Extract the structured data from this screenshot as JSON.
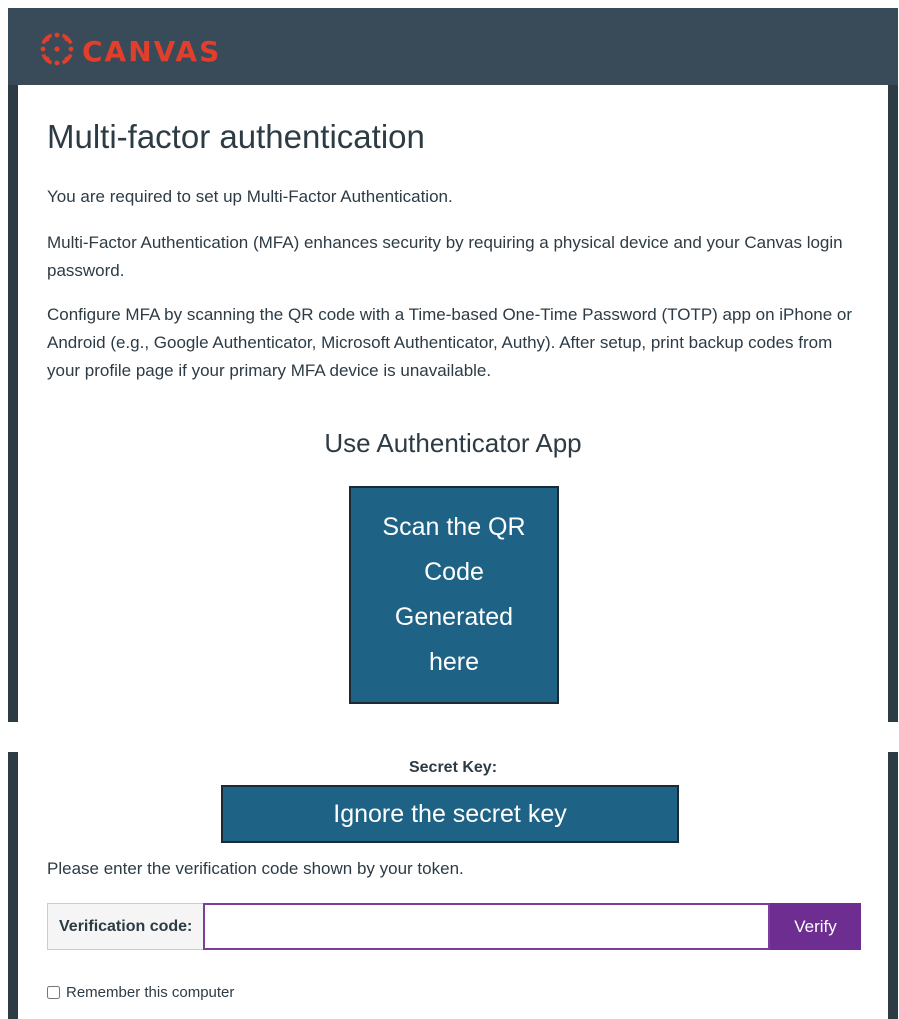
{
  "brand": {
    "name": "CANVAS",
    "logo_icon": "canvas-logo-icon",
    "color": "#e13f2b"
  },
  "page": {
    "title": "Multi-factor authentication",
    "paragraphs": [
      "You are required to set up Multi-Factor Authentication.",
      "Multi-Factor Authentication (MFA) enhances security by requiring a physical device and your Canvas login password.",
      "Configure MFA by scanning the QR code with a Time-based One-Time Password (TOTP) app on iPhone or Android (e.g., Google Authenticator, Microsoft Authenticator, Authy). After setup, print backup codes from your profile page if your primary MFA device is unavailable."
    ]
  },
  "authenticator": {
    "heading": "Use Authenticator App",
    "qr_placeholder": "Scan the QR Code Generated here",
    "secret_label": "Secret Key:",
    "secret_placeholder": "Ignore the secret key"
  },
  "verification": {
    "instruction": "Please enter the verification code shown by your token.",
    "label": "Verification code:",
    "input_value": "",
    "button_label": "Verify",
    "button_color": "#6e2d91"
  },
  "remember": {
    "label": "Remember this computer",
    "checked": false
  }
}
